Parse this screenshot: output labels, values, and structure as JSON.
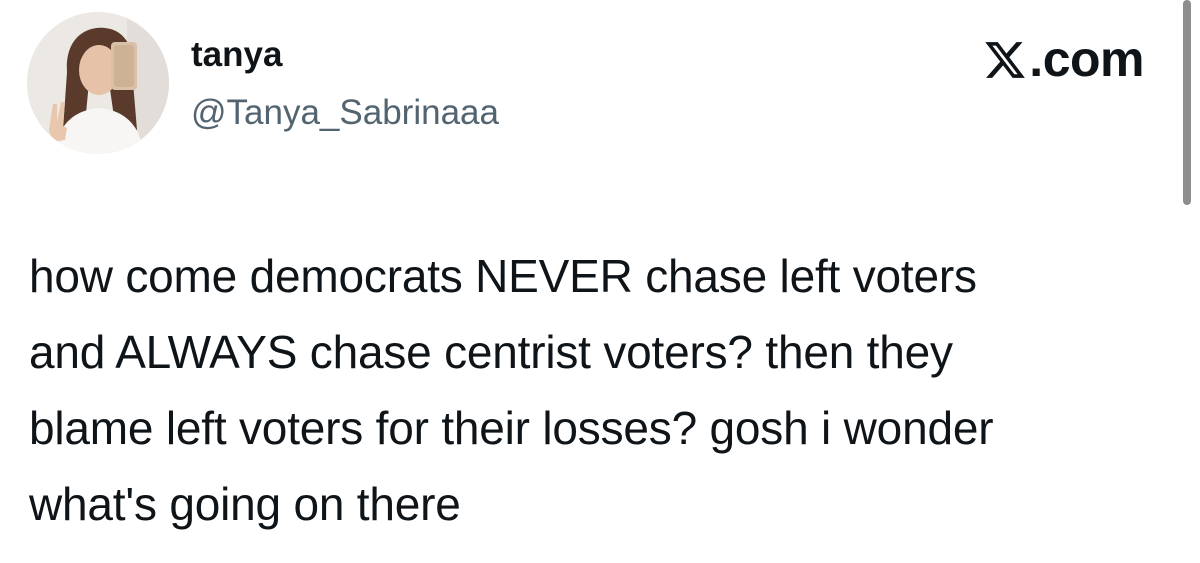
{
  "author": {
    "display_name": "tanya",
    "handle": "@Tanya_Sabrinaaa",
    "avatar_icon": "profile-photo"
  },
  "site": {
    "logo_text": "X.com",
    "logo_icon": "x-logo-icon"
  },
  "tweet": {
    "lines": [
      "how come democrats NEVER chase left voters",
      "and ALWAYS chase centrist voters? then they",
      "blame left voters for their losses? gosh i wonder",
      "what's going on there"
    ]
  },
  "colors": {
    "text_primary": "#0f1419",
    "text_secondary": "#536471",
    "background": "#ffffff"
  }
}
